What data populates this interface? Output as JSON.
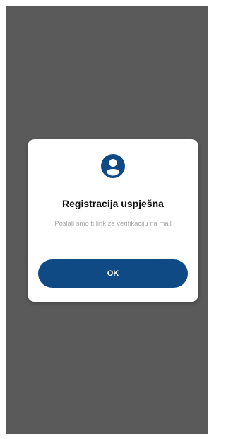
{
  "dialog": {
    "icon": "user-circle-icon",
    "title": "Registracija uspješna",
    "message": "Poslali smo ti link za verifikaciju na mail",
    "ok_label": "OK"
  },
  "colors": {
    "overlay": "#5a5a5a",
    "dialog_bg": "#ffffff",
    "accent": "#0f4a85",
    "message_text": "#a7a7a7"
  }
}
